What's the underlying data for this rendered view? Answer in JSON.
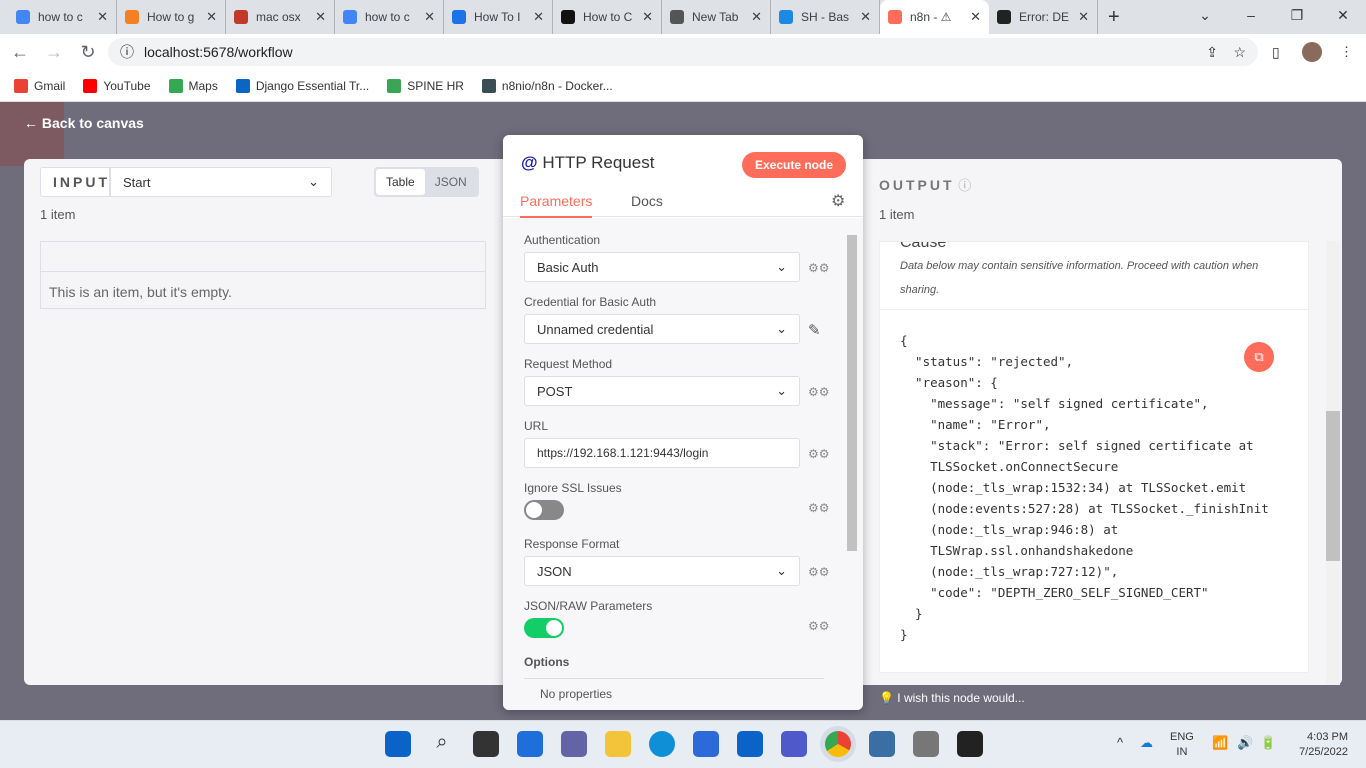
{
  "browser": {
    "tabs": [
      {
        "title": "how to c",
        "color": "#4285f4"
      },
      {
        "title": "How to g",
        "color": "#f48024"
      },
      {
        "title": "mac osx",
        "color": "#c0392b"
      },
      {
        "title": "how to c",
        "color": "#4285f4"
      },
      {
        "title": "How To I",
        "color": "#1a73e8"
      },
      {
        "title": "How to C",
        "color": "#111111"
      },
      {
        "title": "New Tab",
        "color": "#555555"
      },
      {
        "title": "SH - Bas",
        "color": "#1e88e5"
      },
      {
        "title": "n8n - ⚠",
        "color": "#ff6d5a"
      },
      {
        "title": "Error: DE",
        "color": "#222222"
      }
    ],
    "url": "localhost:5678/workflow",
    "bookmarks": [
      {
        "label": "Gmail",
        "color": "#ea4335"
      },
      {
        "label": "YouTube",
        "color": "#ff0000"
      },
      {
        "label": "Maps",
        "color": "#34a853"
      },
      {
        "label": "Django Essential Tr...",
        "color": "#0a66c2"
      },
      {
        "label": "SPINE HR",
        "color": "#3aa655"
      },
      {
        "label": "n8nio/n8n - Docker...",
        "color": "#394d54"
      }
    ]
  },
  "app": {
    "back_label": "Back to canvas",
    "input": {
      "label": "INPUT",
      "node": "Start",
      "view_table": "Table",
      "view_json": "JSON",
      "count": "1 item",
      "empty_msg": "This is an item, but it's empty."
    },
    "node": {
      "title": "HTTP Request",
      "execute": "Execute node",
      "tab_params": "Parameters",
      "tab_docs": "Docs",
      "fields": {
        "auth_label": "Authentication",
        "auth": "Basic Auth",
        "cred_label": "Credential for Basic Auth",
        "cred": "Unnamed credential",
        "method_label": "Request Method",
        "method": "POST",
        "url_label": "URL",
        "url": "https://192.168.1.121:9443/login",
        "ssl_label": "Ignore SSL Issues",
        "format_label": "Response Format",
        "format": "JSON",
        "raw_label": "JSON/RAW Parameters",
        "options_label": "Options",
        "no_props": "No properties"
      },
      "ignore_ssl": false,
      "json_raw": true
    },
    "output": {
      "label": "OUTPUT",
      "count": "1 item",
      "cause": "Cause",
      "warning": "Data below may contain sensitive information. Proceed with caution when sharing.",
      "json_lines": [
        "{",
        "  \"status\": \"rejected\",",
        "  \"reason\": {",
        "    \"message\": \"self signed certificate\",",
        "    \"name\": \"Error\",",
        "    \"stack\": \"Error: self signed certificate at",
        "    TLSSocket.onConnectSecure",
        "    (node:_tls_wrap:1532:34) at TLSSocket.emit",
        "    (node:events:527:28) at TLSSocket._finishInit",
        "    (node:_tls_wrap:946:8) at",
        "    TLSWrap.ssl.onhandshakedone",
        "    (node:_tls_wrap:727:12)\",",
        "    \"code\": \"DEPTH_ZERO_SELF_SIGNED_CERT\"",
        "  }",
        "}"
      ],
      "feedback": "I wish this node would..."
    }
  },
  "taskbar": {
    "lang1": "ENG",
    "lang2": "IN",
    "time": "4:03 PM",
    "date": "7/25/2022"
  },
  "colors": {
    "accent": "#ff6d5a",
    "brand": "#1a1aa6"
  }
}
